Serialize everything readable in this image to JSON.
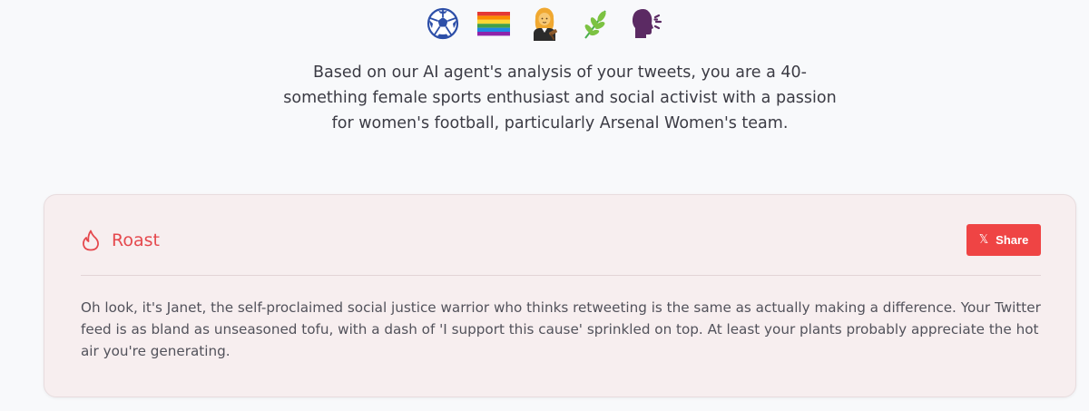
{
  "emojis": [
    {
      "name": "soccer-ball-icon",
      "glyph": "⚽"
    },
    {
      "name": "rainbow-flag-icon",
      "glyph": "🏳️‍🌈"
    },
    {
      "name": "woman-judge-icon",
      "glyph": "👩‍⚖️"
    },
    {
      "name": "herb-icon",
      "glyph": "🌿"
    },
    {
      "name": "speaking-head-icon",
      "glyph": "🗣️"
    }
  ],
  "summary": "Based on our AI agent's analysis of your tweets, you are a 40-something female sports enthusiast and social activist with a passion for women's football, particularly Arsenal Women's team.",
  "roast": {
    "title": "Roast",
    "share_label": "Share",
    "share_icon": "𝕏",
    "text": "Oh look, it's Janet, the self-proclaimed social justice warrior who thinks retweeting is the same as actually making a difference. Your Twitter feed is as bland as unseasoned tofu, with a dash of 'I support this cause' sprinkled on top. At least your plants probably appreciate the hot air you're generating."
  },
  "colors": {
    "accent": "#ef4444",
    "card_background": "#f7eeef",
    "page_background": "#f8f9fb"
  }
}
